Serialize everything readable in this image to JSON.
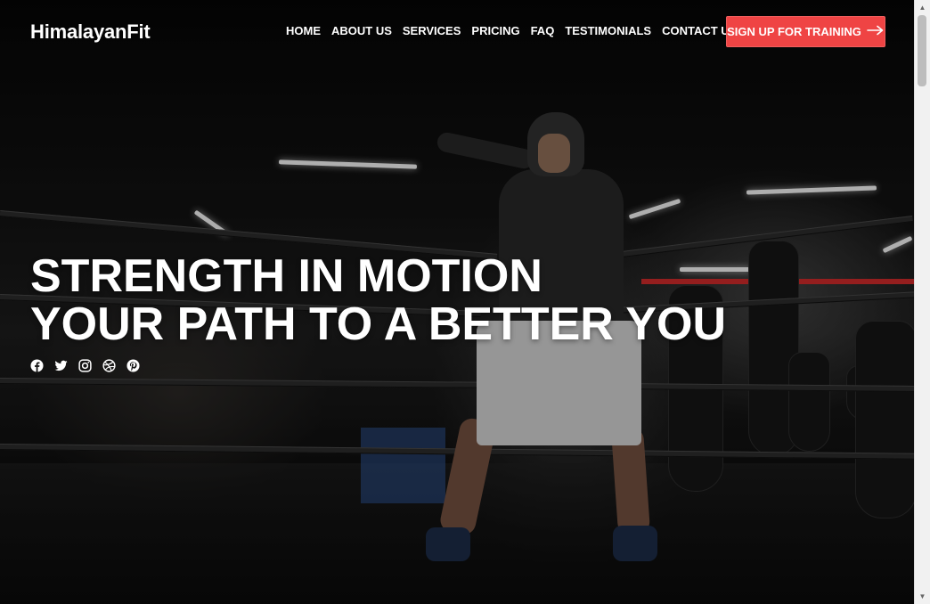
{
  "brand": {
    "name": "HimalayanFit"
  },
  "nav": {
    "items": [
      {
        "label": "HOME"
      },
      {
        "label": "ABOUT US"
      },
      {
        "label": "SERVICES"
      },
      {
        "label": "PRICING"
      },
      {
        "label": "FAQ"
      },
      {
        "label": "TESTIMONIALS"
      },
      {
        "label": "CONTACT US"
      }
    ],
    "cta_label": "SIGN UP FOR TRAINING",
    "cta_icon": "arrow-right-icon",
    "cta_color": "#ef4444"
  },
  "hero": {
    "title_line1": "STRENGTH IN MOTION",
    "title_line2": "YOUR PATH TO A BETTER YOU",
    "socials": [
      {
        "icon": "facebook-icon"
      },
      {
        "icon": "twitter-icon"
      },
      {
        "icon": "instagram-icon"
      },
      {
        "icon": "dribbble-icon"
      },
      {
        "icon": "pinterest-icon"
      }
    ]
  }
}
